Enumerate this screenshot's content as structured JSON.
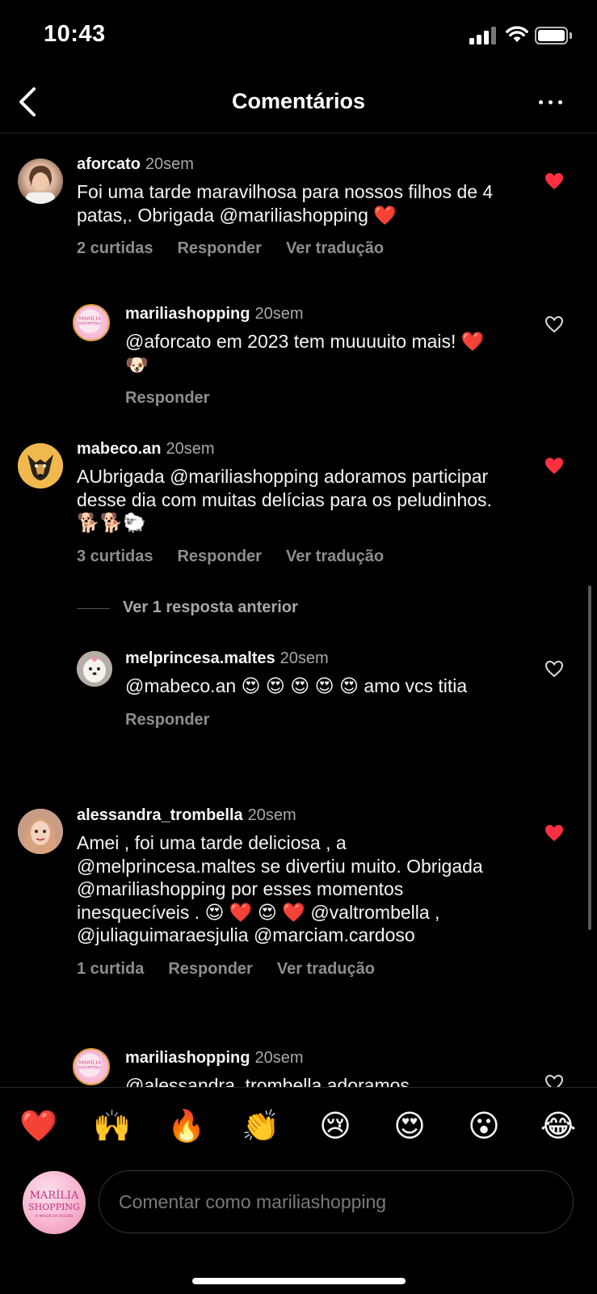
{
  "status": {
    "time": "10:43"
  },
  "header": {
    "title": "Comentários"
  },
  "comments": [
    {
      "user": "aforcato",
      "time": "20sem",
      "text": "Foi uma tarde maravilhosa para nossos filhos de 4 patas,. Obrigada @mariliashopping ❤️",
      "likes": "2 curtidas",
      "reply": "Responder",
      "translate": "Ver tradução",
      "liked": true
    },
    {
      "user": "mariliashopping",
      "time": "20sem",
      "text": "@aforcato em 2023 tem muuuuito mais! ❤️ 🐶",
      "reply": "Responder",
      "liked": false
    },
    {
      "user": "mabeco.an",
      "time": "20sem",
      "text": "AUbrigada @mariliashopping adoramos participar desse dia com muitas delícias para os peludinhos. 🐕🐕🐑",
      "likes": "3 curtidas",
      "reply": "Responder",
      "translate": "Ver tradução",
      "liked": true
    },
    {
      "user": "melprincesa.maltes",
      "time": "20sem",
      "text": "@mabeco.an 😍 😍 😍 😍 😍  amo vcs titia",
      "reply": "Responder",
      "liked": false
    },
    {
      "user": "alessandra_trombella",
      "time": "20sem",
      "text": "Amei , foi uma tarde deliciosa , a @melprincesa.maltes se divertiu muito. Obrigada @mariliashopping por esses momentos inesquecíveis . 😍 ❤️ 😍 ❤️ @valtrombella , @juliaguimaraesjulia @marciam.cardoso",
      "likes": "1 curtida",
      "reply": "Responder",
      "translate": "Ver tradução",
      "liked": true
    },
    {
      "user": "mariliashopping",
      "time": "20sem",
      "text": "@alessandra_trombella adoramos",
      "liked": false
    }
  ],
  "view_replies": "Ver 1 resposta anterior",
  "avatar_logo": {
    "line1": "MARÍLIA",
    "line2": "SHOPPING",
    "tagline": "O MAIOR DA REGIÃO"
  },
  "emoji_bar": [
    "❤️",
    "🙌",
    "🔥",
    "👏",
    "😢",
    "😍",
    "😮",
    "😂"
  ],
  "composer": {
    "placeholder": "Comentar como mariliashopping"
  },
  "colors": {
    "like_red": "#ff3040",
    "background": "#000000",
    "muted": "#8e8e8e"
  }
}
